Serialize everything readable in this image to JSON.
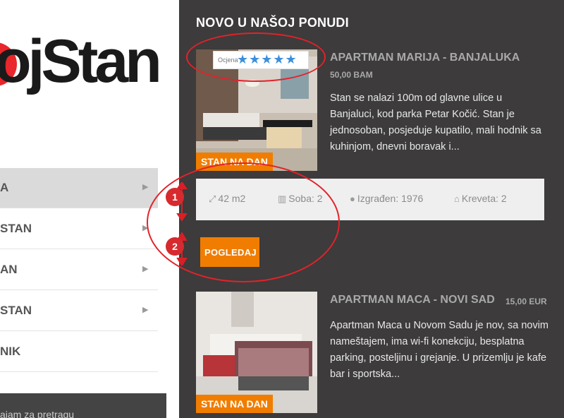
{
  "logo": {
    "text": "ojStan"
  },
  "sidebar": {
    "items": [
      {
        "label": "A"
      },
      {
        "label": "STAN"
      },
      {
        "label": "AN"
      },
      {
        "label": "STAN"
      },
      {
        "label": "NIK"
      }
    ],
    "search_label": "ajam za pretragu"
  },
  "main": {
    "title": "NOVO U NAŠOJ PONUDI",
    "listings": [
      {
        "title": "APARTMAN MARIJA - BANJALUKA",
        "price": "50,00 BAM",
        "badge": "STAN NA DAN",
        "rating_label": "Ocjena",
        "rating_stars": 5,
        "stars_text": "★★★★★",
        "description": "Stan se nalazi 100m od glavne ulice u Banjaluci, kod parka Petar Kočić. Stan je jednosoban, posjeduje kupatilo, mali hodnik sa kuhinjom, dnevni boravak i...",
        "features": {
          "area": "42 m2",
          "rooms": "Soba: 2",
          "built": "Izgrađen: 1976",
          "beds": "Kreveta: 2"
        },
        "button": "POGLEDAJ"
      },
      {
        "title": "APARTMAN MACA - NOVI SAD",
        "price": "15,00 EUR",
        "badge": "STAN NA DAN",
        "description": "Apartman Maca u Novom Sadu je nov, sa novim nameštajem, ima wi-fi konekciju, besplatna parking, posteljinu i grejanje. U prizemlju je kafe bar i sportska..."
      }
    ]
  },
  "annotations": {
    "step1": "1",
    "step2": "2"
  },
  "colors": {
    "accent": "#f07d00",
    "panel": "#3d3b3b",
    "star": "#3b8fd9",
    "annotation": "#e3222a"
  }
}
